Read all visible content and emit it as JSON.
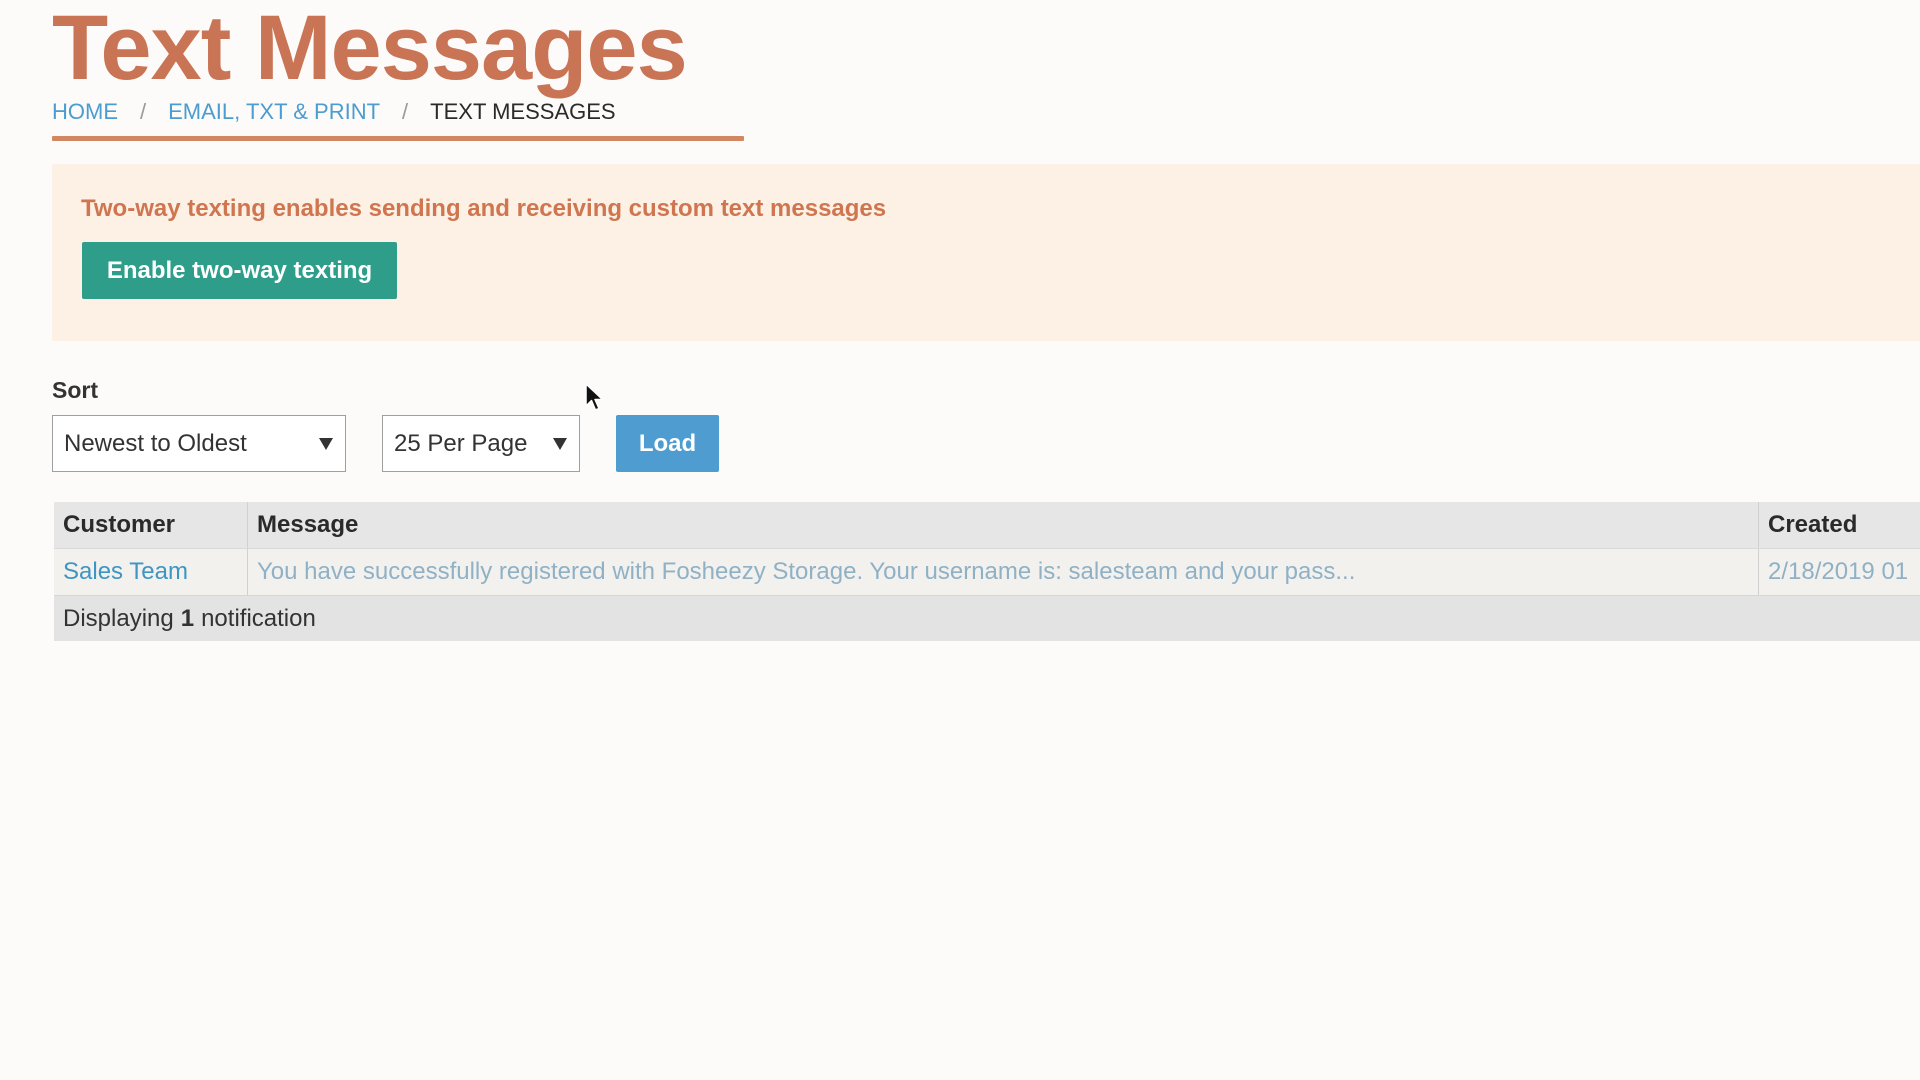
{
  "page": {
    "title": "Text Messages"
  },
  "breadcrumb": {
    "home": "HOME",
    "section": "EMAIL, TXT & PRINT",
    "current": "TEXT MESSAGES",
    "separator": "/"
  },
  "banner": {
    "text": "Two-way texting enables sending and receiving custom text messages",
    "button_label": "Enable two-way texting"
  },
  "controls": {
    "sort_label": "Sort",
    "sort_selected": "Newest to Oldest",
    "per_page_selected": "25 Per Page",
    "load_label": "Load"
  },
  "table": {
    "headers": {
      "customer": "Customer",
      "message": "Message",
      "created": "Created"
    },
    "rows": [
      {
        "customer": "Sales Team",
        "message": "You have successfully registered with Fosheezy Storage. Your username is: salesteam and your pass...",
        "created": "2/18/2019 01"
      }
    ],
    "footer": {
      "prefix": "Displaying",
      "count": "1",
      "suffix": "notification"
    }
  },
  "colors": {
    "title": "#c97454",
    "link": "#4b9ccf",
    "banner_bg": "#fdf0e4",
    "banner_text": "#cf7650",
    "enable_button": "#2e9e8a",
    "load_button": "#4f9cd1"
  },
  "icons": {
    "select_arrow": "chevron-down-icon",
    "pointer": "cursor-icon"
  }
}
